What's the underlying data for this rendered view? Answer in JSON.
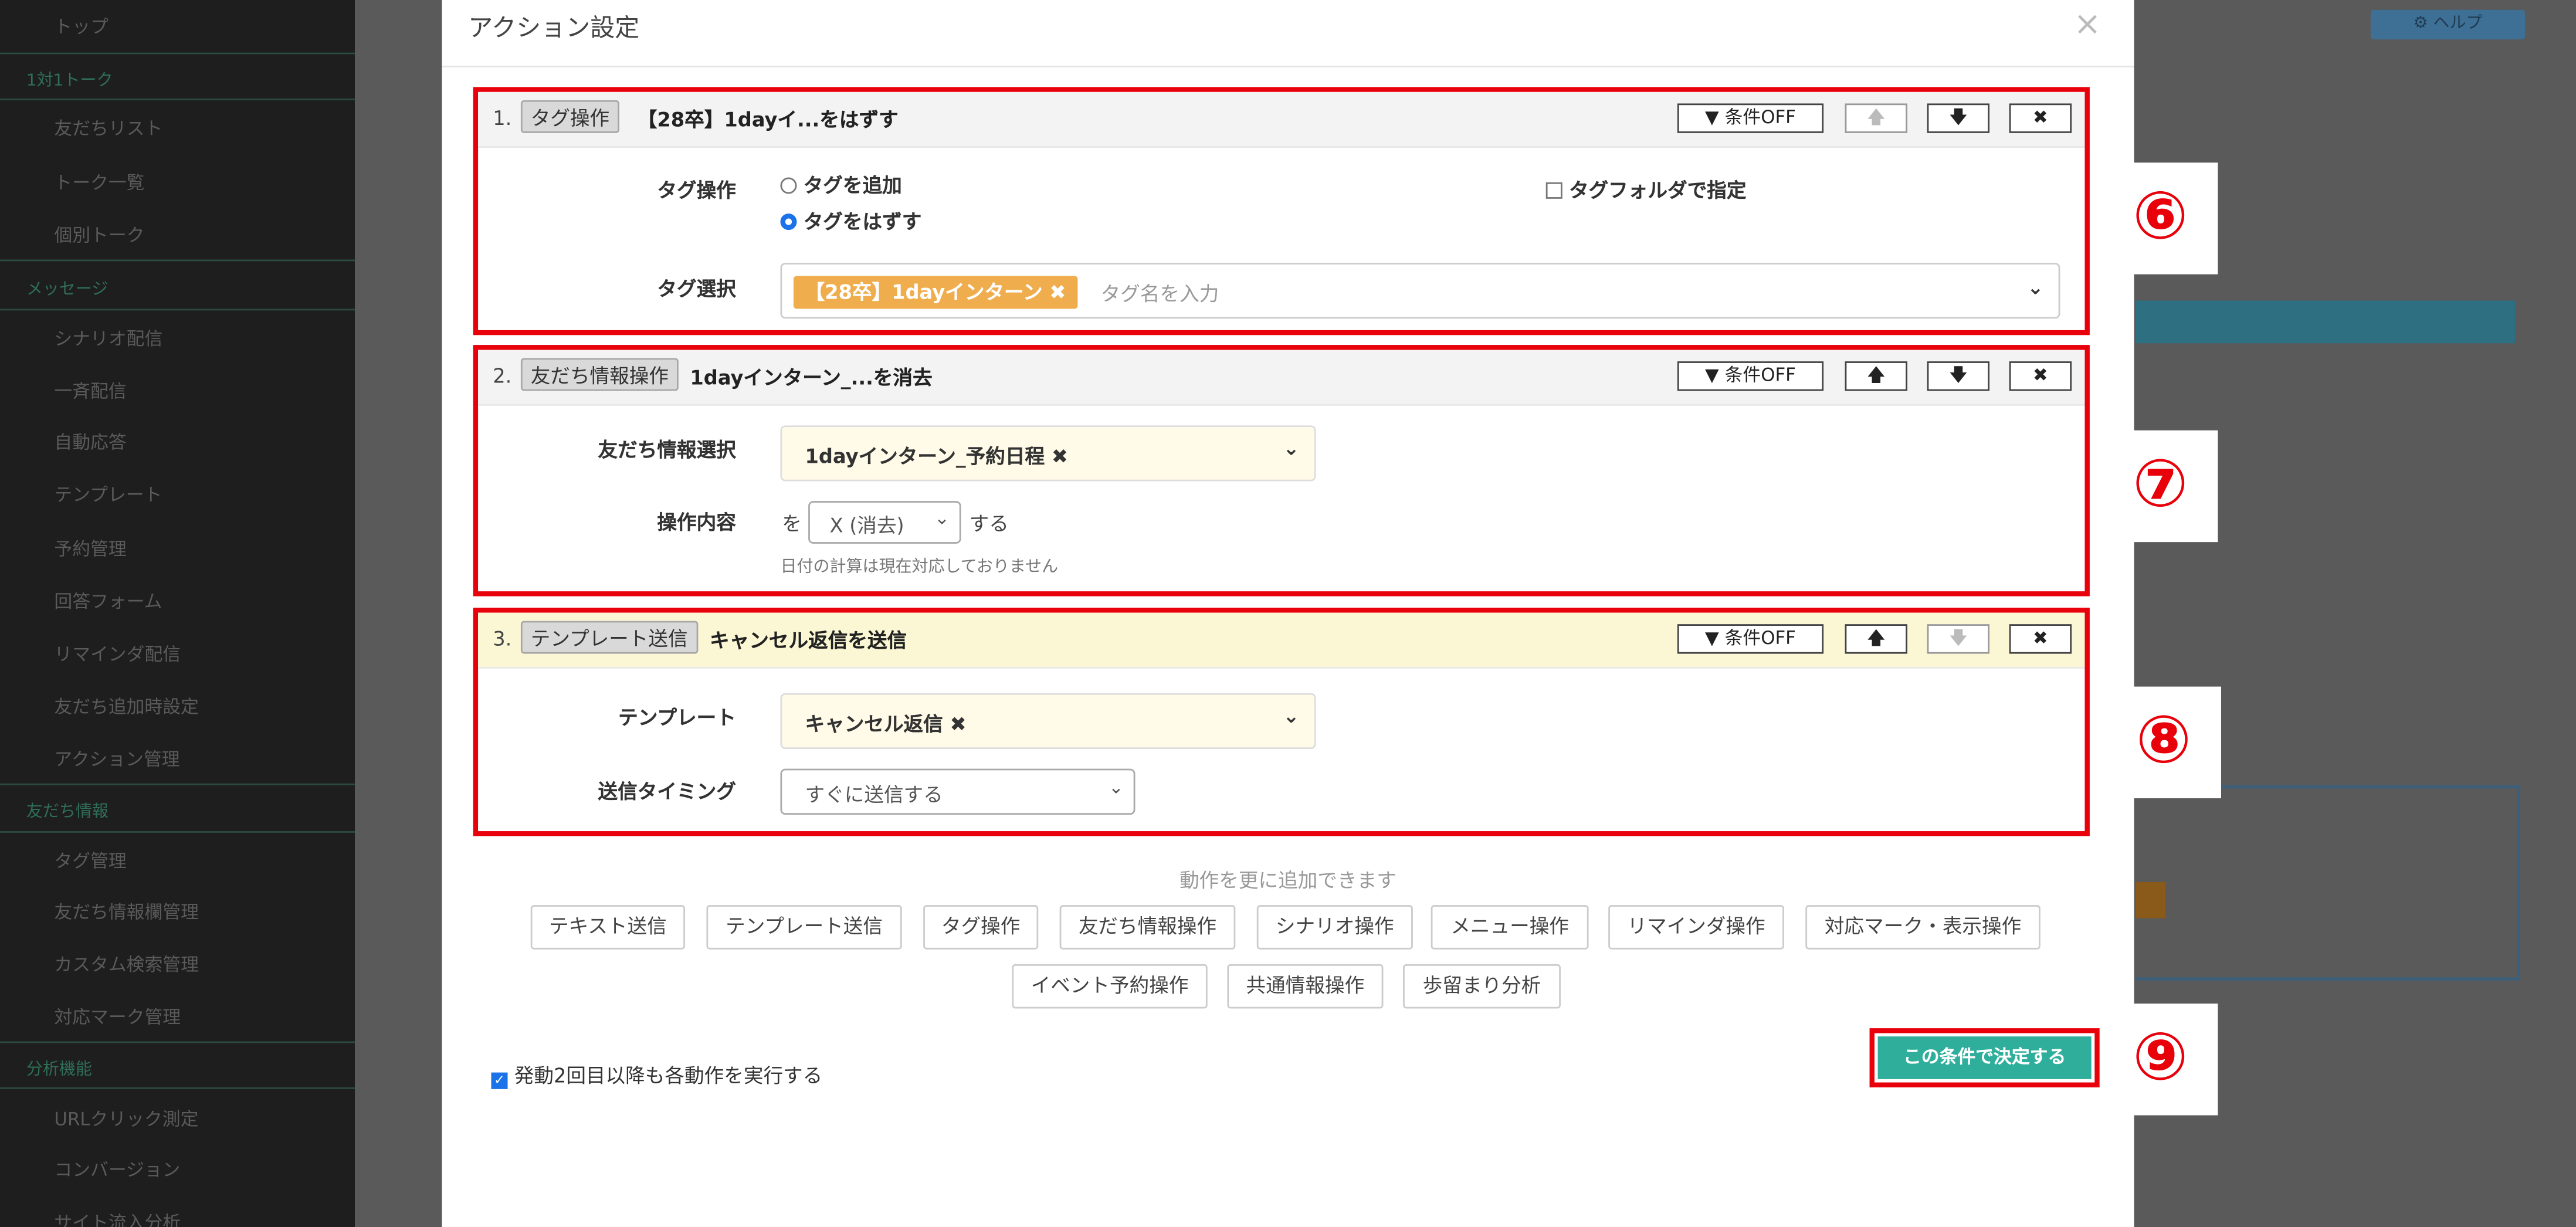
{
  "background": {
    "sidebar": {
      "items": [
        "トップ",
        "友だちリスト",
        "トーク一覧",
        "個別トーク",
        "シナリオ配信",
        "一斉配信",
        "自動応答",
        "テンプレート",
        "予約管理",
        "回答フォーム",
        "リマインダ配信",
        "友だち追加時設定",
        "アクション管理",
        "タグ管理",
        "友だち情報欄管理",
        "カスタム検索管理",
        "対応マーク管理",
        "URLクリック測定",
        "コンバージョン",
        "サイト流入分析"
      ],
      "sections": [
        "1対1トーク",
        "メッセージ",
        "友だち情報",
        "分析機能"
      ]
    },
    "help_label": "ヘルプ"
  },
  "modal": {
    "title": "アクション設定",
    "close_icon": "×"
  },
  "blocks": [
    {
      "number": "1.",
      "chip": "タグ操作",
      "title": "【28卒】1dayイ...をはずす",
      "condition_btn": "条件OFF",
      "fields": {
        "tag_op_label": "タグ操作",
        "add_option": "タグを追加",
        "remove_option": "タグをはずす",
        "selected_option": "remove",
        "folder_checkbox": "タグフォルダで指定",
        "tag_select_label": "タグ選択",
        "tag_value": "【28卒】1dayインターン ✖",
        "tag_placeholder": "タグ名を入力"
      }
    },
    {
      "number": "2.",
      "chip": "友だち情報操作",
      "title": "1dayインターン_...を消去",
      "condition_btn": "条件OFF",
      "fields": {
        "info_label": "友だち情報選択",
        "info_value": "1dayインターン_予約日程 ✖",
        "op_label": "操作内容",
        "op_prefix": "を",
        "op_value": "X (消去)",
        "op_suffix": "する",
        "note": "日付の計算は現在対応しておりません"
      }
    },
    {
      "number": "3.",
      "chip": "テンプレート送信",
      "title": "キャンセル返信を送信",
      "condition_btn": "条件OFF",
      "fields": {
        "template_label": "テンプレート",
        "template_value": "キャンセル返信 ✖",
        "timing_label": "送信タイミング",
        "timing_value": "すぐに送信する"
      }
    }
  ],
  "add_actions": {
    "note": "動作を更に追加できます",
    "row1": [
      "テキスト送信",
      "テンプレート送信",
      "タグ操作",
      "友だち情報操作",
      "シナリオ操作",
      "メニュー操作",
      "リマインダ操作",
      "対応マーク・表示操作"
    ],
    "row2": [
      "イベント予約操作",
      "共通情報操作",
      "歩留まり分析"
    ]
  },
  "repeat_checkbox": {
    "label": "発動2回目以降も各動作を実行する",
    "checked": true
  },
  "confirm_button": "この条件で決定する",
  "annotations": [
    "⑥",
    "⑦",
    "⑧",
    "⑨"
  ],
  "colors": {
    "highlight_red": "#e8000b",
    "confirm_teal": "#2fae9b",
    "tag_orange": "#f0ad4e"
  }
}
